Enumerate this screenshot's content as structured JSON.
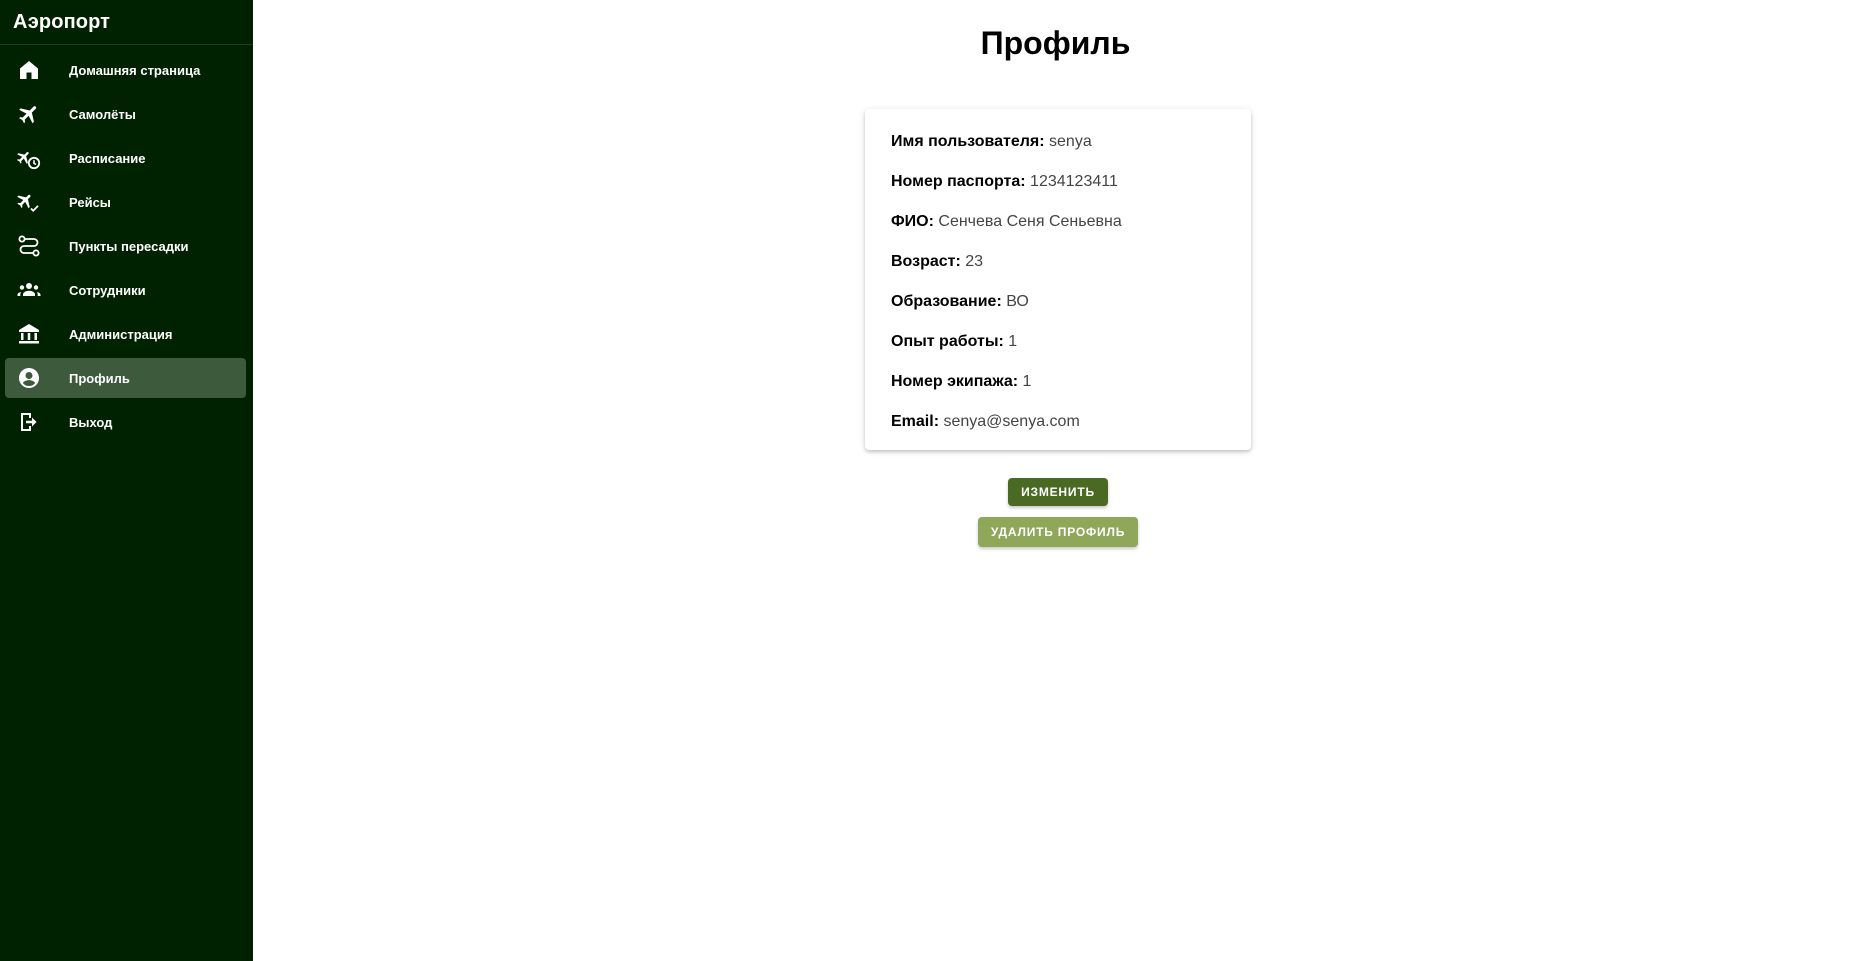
{
  "sidebar": {
    "title": "Аэропорт",
    "items": [
      {
        "label": "Домашняя страница",
        "icon": "home-icon"
      },
      {
        "label": "Самолёты",
        "icon": "airplane-icon"
      },
      {
        "label": "Расписание",
        "icon": "schedule-icon"
      },
      {
        "label": "Рейсы",
        "icon": "flight-check-icon"
      },
      {
        "label": "Пункты пересадки",
        "icon": "route-icon"
      },
      {
        "label": "Сотрудники",
        "icon": "people-icon"
      },
      {
        "label": "Администрация",
        "icon": "institution-icon"
      },
      {
        "label": "Профиль",
        "icon": "account-circle-icon",
        "active": true
      },
      {
        "label": "Выход",
        "icon": "logout-icon"
      }
    ]
  },
  "main": {
    "title": "Профиль",
    "profile": {
      "fields": [
        {
          "label": "Имя пользователя:",
          "value": "senya"
        },
        {
          "label": "Номер паспорта:",
          "value": "1234123411"
        },
        {
          "label": "ФИО:",
          "value": "Сенчева Сеня Сеньевна"
        },
        {
          "label": "Возраст:",
          "value": "23"
        },
        {
          "label": "Образование:",
          "value": "ВО"
        },
        {
          "label": "Опыт работы:",
          "value": "1"
        },
        {
          "label": "Номер экипажа:",
          "value": "1"
        },
        {
          "label": "Email:",
          "value": "senya@senya.com"
        }
      ]
    },
    "buttons": {
      "edit": "Изменить",
      "delete": "Удалить профиль"
    }
  },
  "colors": {
    "sidebar_bg": "#012201",
    "sidebar_active": "#3e5a3d",
    "edit_button": "#4a6a23",
    "delete_button": "#8fa759"
  }
}
